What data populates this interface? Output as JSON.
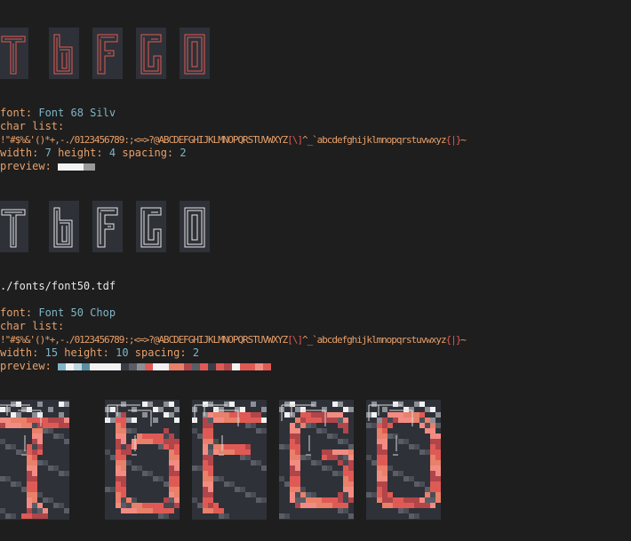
{
  "top_row": {
    "glyph_names": [
      "T",
      "b",
      "F",
      "G",
      "O"
    ],
    "stroke_color": "#e05a55"
  },
  "font1": {
    "font_label": "font:",
    "font_name": "Font 68 Silv",
    "charlist_label": "char list:",
    "chars_a": "!\"#$%&'()*+,-./0123456789:;<=>?@ABCDEFGHIJKLMNOPQRSTUVWXYZ",
    "chars_b": "[\\]",
    "chars_c": "^_`abcdefghijklmnopqrstuvwxyz",
    "chars_d": "{|}",
    "chars_e": "~",
    "width_label": "width:",
    "width": "7",
    "height_label": "height:",
    "height": "4",
    "spacing_label": "spacing:",
    "spacing": "2",
    "preview_label": "preview:",
    "preview_colors": [
      "#f2f2f2",
      "#f2f2f2",
      "#f2f2f2",
      "#f2f2f2",
      "#f2f2f2",
      "#f2f2f2",
      "#f2f2f2",
      "#9a9a9a",
      "#9a9a9a",
      "#9a9a9a"
    ],
    "glyph_names": [
      "T",
      "b",
      "F",
      "G",
      "O"
    ],
    "stroke_color": "#e8e8e8"
  },
  "font2": {
    "path": "./fonts/font50.tdf",
    "font_label": "font:",
    "font_name": "Font 50 Chop",
    "charlist_label": "char list:",
    "chars_a": "!\"#$%&'()*+,-./0123456789:;<=>?@ABCDEFGHIJKLMNOPQRSTUVWXYZ",
    "chars_b": "[\\]",
    "chars_c": "^_`abcdefghijklmnopqrstuvwxyz",
    "chars_d": "{|}",
    "chars_e": "~",
    "width_label": "width:",
    "width": "15",
    "height_label": "height:",
    "height": "10",
    "spacing_label": "spacing:",
    "spacing": "2",
    "preview_label": "preview:",
    "preview_colors": [
      "#7fb5c6",
      "#f2f2f2",
      "#bcd7e2",
      "#5a8fa2",
      "#f2f2f2",
      "#f2f2f2",
      "#f2f2f2",
      "#f2f2f2",
      "#3a3d44",
      "#5a5d66",
      "#8c8f96",
      "#e05a55",
      "#f2f2f2",
      "#f2f2f2",
      "#e8806a",
      "#e8806a",
      "#b0454a",
      "#5a5d66",
      "#e05a55",
      "#3a3d44",
      "#e05a55",
      "#b0454a",
      "#f2f2f2",
      "#e05a55",
      "#e05a55",
      "#f28c82",
      "#e05a55"
    ],
    "glyph_names": [
      "T",
      "b",
      "F",
      "G",
      "O"
    ]
  }
}
